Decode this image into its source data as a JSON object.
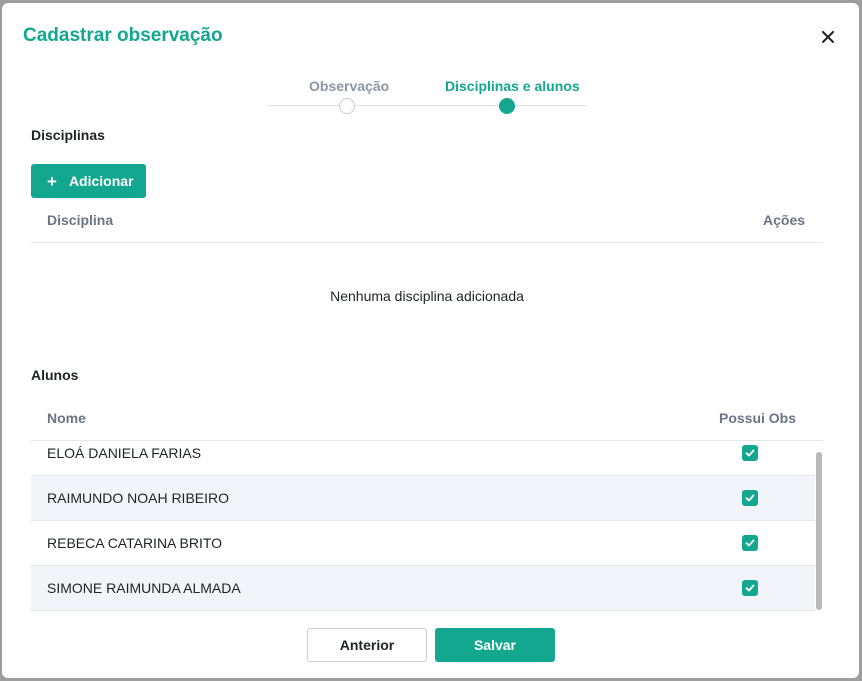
{
  "modal": {
    "title": "Cadastrar observação"
  },
  "stepper": {
    "steps": [
      {
        "label": "Observação",
        "state": "completed"
      },
      {
        "label": "Disciplinas e alunos",
        "state": "active"
      }
    ]
  },
  "disciplinas": {
    "section_title": "Disciplinas",
    "add_label": "Adicionar",
    "columns": [
      "Disciplina",
      "Ações"
    ],
    "empty_message": "Nenhuma disciplina adicionada"
  },
  "alunos": {
    "section_title": "Alunos",
    "columns": [
      "Nome",
      "Possui Obs"
    ],
    "rows": [
      {
        "name": "ELOÁ DANIELA FARIAS",
        "possui_obs": true
      },
      {
        "name": "RAIMUNDO NOAH RIBEIRO",
        "possui_obs": true
      },
      {
        "name": "REBECA CATARINA BRITO",
        "possui_obs": true
      },
      {
        "name": "SIMONE RAIMUNDA ALMADA",
        "possui_obs": true
      }
    ]
  },
  "footer": {
    "previous_label": "Anterior",
    "save_label": "Salvar"
  },
  "colors": {
    "accent": "#13a78f",
    "header_text": "#6a7686",
    "row_alt": "#f1f4f8"
  },
  "icons": {
    "close": "close-icon",
    "add": "plus-icon",
    "checkbox": "check-icon"
  }
}
